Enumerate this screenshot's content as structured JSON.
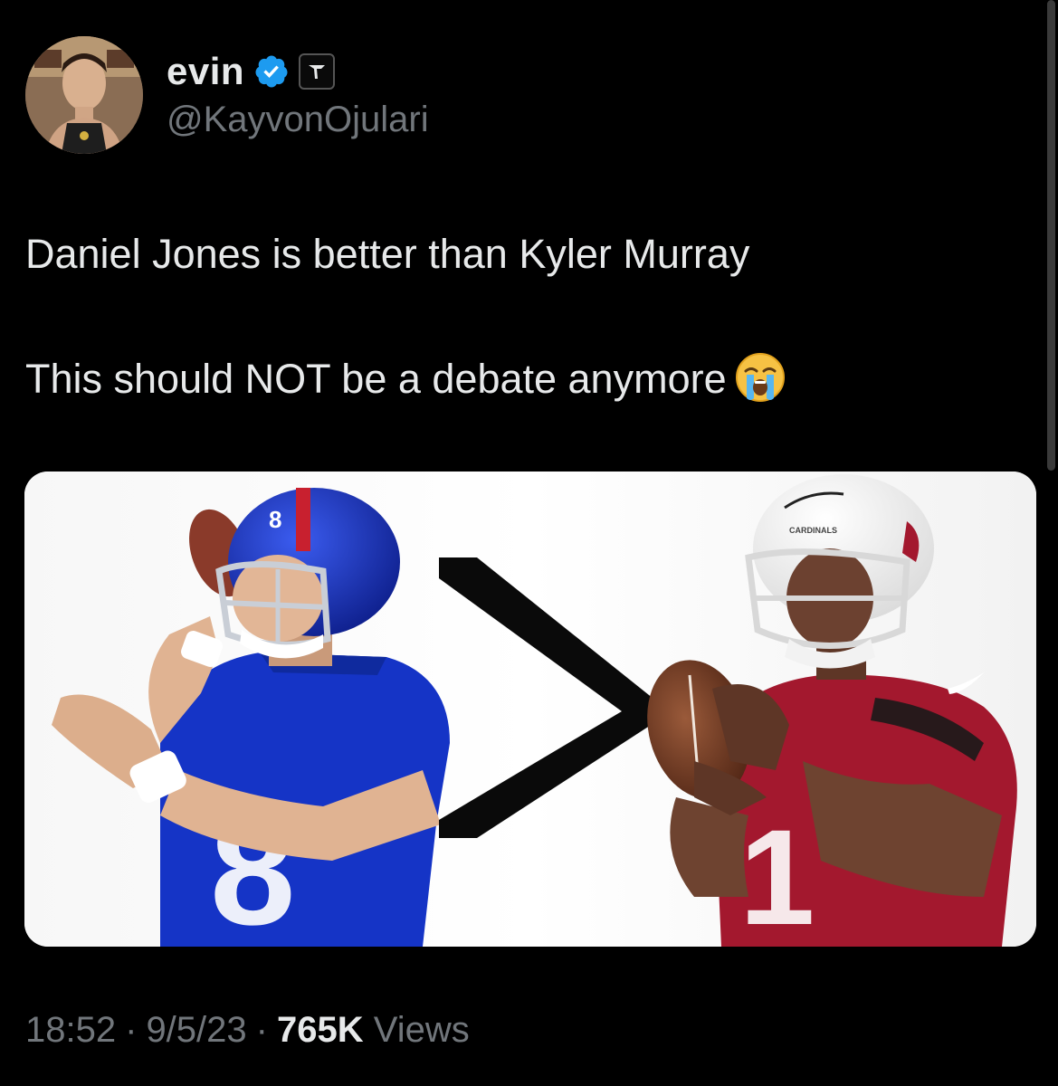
{
  "author": {
    "display_name": "evin",
    "handle": "@KayvonOjulari",
    "verified": true
  },
  "tweet": {
    "line1": "Daniel Jones is better than Kyler Murray",
    "line2": "This should NOT be a debate anymore",
    "emoji": "loudly-crying-face"
  },
  "media": {
    "comparison_symbol": ">",
    "left_player_jersey_number": "8",
    "right_player_jersey_number": "1"
  },
  "meta": {
    "time": "18:52",
    "separator": "·",
    "date": "9/5/23",
    "views_count": "765K",
    "views_label": "Views"
  },
  "colors": {
    "background": "#000000",
    "text_primary": "#e7e9ea",
    "text_secondary": "#71767b",
    "verified_blue": "#1d9bf0",
    "giants_blue": "#1534c6",
    "cardinals_red": "#a3182e"
  }
}
